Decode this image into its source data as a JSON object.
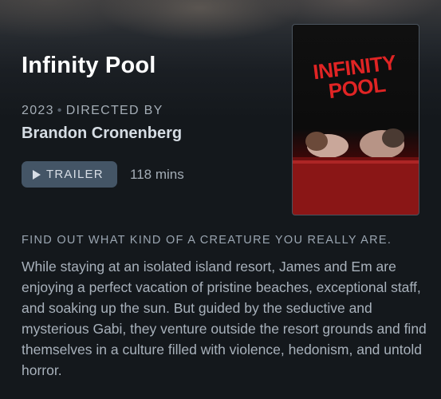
{
  "film": {
    "title": "Infinity Pool",
    "year": "2023",
    "directed_by_label": "DIRECTED BY",
    "director": "Brandon Cronenberg",
    "trailer_label": "TRAILER",
    "runtime": "118 mins",
    "poster_title_line1": "INFINITY",
    "poster_title_line2": "POOL",
    "tagline": "FIND OUT WHAT KIND OF A CREATURE YOU REALLY ARE.",
    "synopsis": "While staying at an isolated island resort, James and Em are enjoying a perfect vacation of pristine beaches, exceptional staff, and soaking up the sun. But guided by the seductive and mysterious Gabi, they venture outside the resort grounds and find themselves in a culture filled with violence, hedonism, and untold horror."
  },
  "icons": {
    "trailer": "play-icon"
  },
  "colors": {
    "background": "#14181c",
    "button": "#445566",
    "poster_accent": "#e02424"
  }
}
